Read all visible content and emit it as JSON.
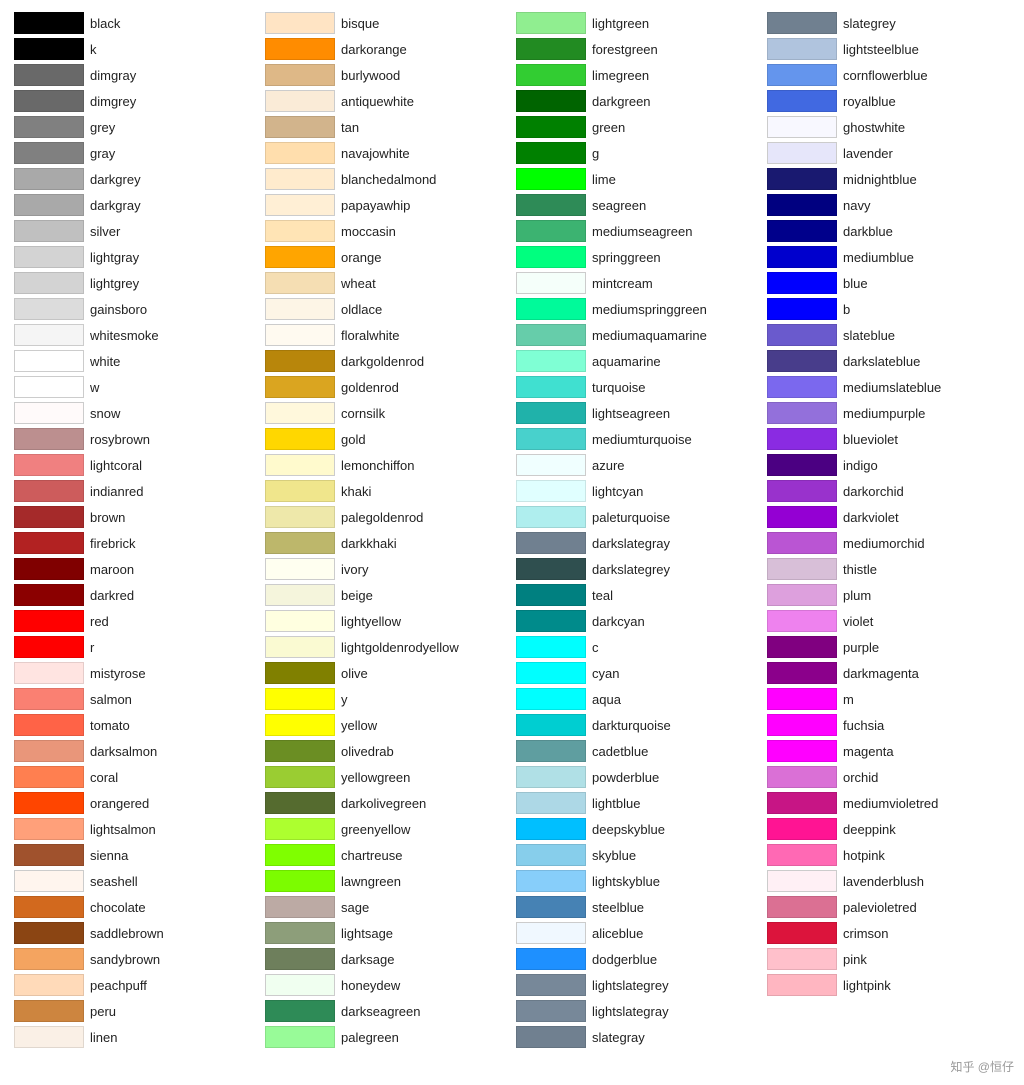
{
  "columns": [
    [
      {
        "color": "#000000",
        "name": "black"
      },
      {
        "color": "#000000",
        "name": "k"
      },
      {
        "color": "#696969",
        "name": "dimgray"
      },
      {
        "color": "#696969",
        "name": "dimgrey"
      },
      {
        "color": "#808080",
        "name": "grey"
      },
      {
        "color": "#808080",
        "name": "gray"
      },
      {
        "color": "#a9a9a9",
        "name": "darkgrey"
      },
      {
        "color": "#a9a9a9",
        "name": "darkgray"
      },
      {
        "color": "#c0c0c0",
        "name": "silver"
      },
      {
        "color": "#d3d3d3",
        "name": "lightgray"
      },
      {
        "color": "#d3d3d3",
        "name": "lightgrey"
      },
      {
        "color": "#dcdcdc",
        "name": "gainsboro"
      },
      {
        "color": "#f5f5f5",
        "name": "whitesmoke"
      },
      {
        "color": "#ffffff",
        "name": "white"
      },
      {
        "color": "#ffffff",
        "name": "w"
      },
      {
        "color": "#fffafa",
        "name": "snow"
      },
      {
        "color": "#bc8f8f",
        "name": "rosybrown"
      },
      {
        "color": "#f08080",
        "name": "lightcoral"
      },
      {
        "color": "#cd5c5c",
        "name": "indianred"
      },
      {
        "color": "#a52a2a",
        "name": "brown"
      },
      {
        "color": "#b22222",
        "name": "firebrick"
      },
      {
        "color": "#800000",
        "name": "maroon"
      },
      {
        "color": "#8b0000",
        "name": "darkred"
      },
      {
        "color": "#ff0000",
        "name": "red"
      },
      {
        "color": "#ff0000",
        "name": "r"
      },
      {
        "color": "#ffe4e1",
        "name": "mistyrose"
      },
      {
        "color": "#fa8072",
        "name": "salmon"
      },
      {
        "color": "#ff6347",
        "name": "tomato"
      },
      {
        "color": "#e9967a",
        "name": "darksalmon"
      },
      {
        "color": "#ff7f50",
        "name": "coral"
      },
      {
        "color": "#ff4500",
        "name": "orangered"
      },
      {
        "color": "#ffa07a",
        "name": "lightsalmon"
      },
      {
        "color": "#a0522d",
        "name": "sienna"
      },
      {
        "color": "#fff5ee",
        "name": "seashell"
      },
      {
        "color": "#d2691e",
        "name": "chocolate"
      },
      {
        "color": "#8b4513",
        "name": "saddlebrown"
      },
      {
        "color": "#f4a460",
        "name": "sandybrown"
      },
      {
        "color": "#ffdab9",
        "name": "peachpuff"
      },
      {
        "color": "#cd853f",
        "name": "peru"
      },
      {
        "color": "#faf0e6",
        "name": "linen"
      }
    ],
    [
      {
        "color": "#ffe4c4",
        "name": "bisque"
      },
      {
        "color": "#ff8c00",
        "name": "darkorange"
      },
      {
        "color": "#deb887",
        "name": "burlywood"
      },
      {
        "color": "#faebd7",
        "name": "antiquewhite"
      },
      {
        "color": "#d2b48c",
        "name": "tan"
      },
      {
        "color": "#ffdead",
        "name": "navajowhite"
      },
      {
        "color": "#ffebcd",
        "name": "blanchedalmond"
      },
      {
        "color": "#ffefd5",
        "name": "papayawhip"
      },
      {
        "color": "#ffe4b5",
        "name": "moccasin"
      },
      {
        "color": "#ffa500",
        "name": "orange"
      },
      {
        "color": "#f5deb3",
        "name": "wheat"
      },
      {
        "color": "#fdf5e6",
        "name": "oldlace"
      },
      {
        "color": "#fffaf0",
        "name": "floralwhite"
      },
      {
        "color": "#b8860b",
        "name": "darkgoldenrod"
      },
      {
        "color": "#daa520",
        "name": "goldenrod"
      },
      {
        "color": "#fff8dc",
        "name": "cornsilk"
      },
      {
        "color": "#ffd700",
        "name": "gold"
      },
      {
        "color": "#fffacd",
        "name": "lemonchiffon"
      },
      {
        "color": "#f0e68c",
        "name": "khaki"
      },
      {
        "color": "#eee8aa",
        "name": "palegoldenrod"
      },
      {
        "color": "#bdb76b",
        "name": "darkkhaki"
      },
      {
        "color": "#fffff0",
        "name": "ivory"
      },
      {
        "color": "#f5f5dc",
        "name": "beige"
      },
      {
        "color": "#ffffe0",
        "name": "lightyellow"
      },
      {
        "color": "#fafad2",
        "name": "lightgoldenrodyellow"
      },
      {
        "color": "#808000",
        "name": "olive"
      },
      {
        "color": "#ffff00",
        "name": "y"
      },
      {
        "color": "#ffff00",
        "name": "yellow"
      },
      {
        "color": "#6b8e23",
        "name": "olivedrab"
      },
      {
        "color": "#9acd32",
        "name": "yellowgreen"
      },
      {
        "color": "#556b2f",
        "name": "darkolivegreen"
      },
      {
        "color": "#adff2f",
        "name": "greenyellow"
      },
      {
        "color": "#7fff00",
        "name": "chartreuse"
      },
      {
        "color": "#7cfc00",
        "name": "lawngreen"
      },
      {
        "color": "#bcaaa4",
        "name": "sage"
      },
      {
        "color": "#8d9e7a",
        "name": "lightsage"
      },
      {
        "color": "#6e7f5c",
        "name": "darksage"
      },
      {
        "color": "#f0fff0",
        "name": "honeydew"
      },
      {
        "color": "#2e8b57",
        "name": "darkseagreen"
      },
      {
        "color": "#98fb98",
        "name": "palegreen"
      }
    ],
    [
      {
        "color": "#90ee90",
        "name": "lightgreen"
      },
      {
        "color": "#228b22",
        "name": "forestgreen"
      },
      {
        "color": "#32cd32",
        "name": "limegreen"
      },
      {
        "color": "#006400",
        "name": "darkgreen"
      },
      {
        "color": "#008000",
        "name": "green"
      },
      {
        "color": "#008000",
        "name": "g"
      },
      {
        "color": "#00ff00",
        "name": "lime"
      },
      {
        "color": "#2e8b57",
        "name": "seagreen"
      },
      {
        "color": "#3cb371",
        "name": "mediumseagreen"
      },
      {
        "color": "#00ff7f",
        "name": "springgreen"
      },
      {
        "color": "#f5fffa",
        "name": "mintcream"
      },
      {
        "color": "#00fa9a",
        "name": "mediumspringgreen"
      },
      {
        "color": "#66cdaa",
        "name": "mediumaquamarine"
      },
      {
        "color": "#7fffd4",
        "name": "aquamarine"
      },
      {
        "color": "#40e0d0",
        "name": "turquoise"
      },
      {
        "color": "#20b2aa",
        "name": "lightseagreen"
      },
      {
        "color": "#48d1cc",
        "name": "mediumturquoise"
      },
      {
        "color": "#f0ffff",
        "name": "azure"
      },
      {
        "color": "#e0ffff",
        "name": "lightcyan"
      },
      {
        "color": "#afeeee",
        "name": "paleturquoise"
      },
      {
        "color": "#708090",
        "name": "darkslategray"
      },
      {
        "color": "#2f4f4f",
        "name": "darkslategrey"
      },
      {
        "color": "#008080",
        "name": "teal"
      },
      {
        "color": "#008b8b",
        "name": "darkcyan"
      },
      {
        "color": "#00ffff",
        "name": "c"
      },
      {
        "color": "#00ffff",
        "name": "cyan"
      },
      {
        "color": "#00ffff",
        "name": "aqua"
      },
      {
        "color": "#00ced1",
        "name": "darkturquoise"
      },
      {
        "color": "#5f9ea0",
        "name": "cadetblue"
      },
      {
        "color": "#b0e0e6",
        "name": "powderblue"
      },
      {
        "color": "#add8e6",
        "name": "lightblue"
      },
      {
        "color": "#00bfff",
        "name": "deepskyblue"
      },
      {
        "color": "#87ceeb",
        "name": "skyblue"
      },
      {
        "color": "#87cefa",
        "name": "lightskyblue"
      },
      {
        "color": "#4682b4",
        "name": "steelblue"
      },
      {
        "color": "#f0f8ff",
        "name": "aliceblue"
      },
      {
        "color": "#1e90ff",
        "name": "dodgerblue"
      },
      {
        "color": "#778899",
        "name": "lightslategrey"
      },
      {
        "color": "#778899",
        "name": "lightslategray"
      },
      {
        "color": "#708090",
        "name": "slategray"
      }
    ],
    [
      {
        "color": "#708090",
        "name": "slategrey"
      },
      {
        "color": "#b0c4de",
        "name": "lightsteelblue"
      },
      {
        "color": "#6495ed",
        "name": "cornflowerblue"
      },
      {
        "color": "#4169e1",
        "name": "royalblue"
      },
      {
        "color": "#f8f8ff",
        "name": "ghostwhite"
      },
      {
        "color": "#e6e6fa",
        "name": "lavender"
      },
      {
        "color": "#191970",
        "name": "midnightblue"
      },
      {
        "color": "#000080",
        "name": "navy"
      },
      {
        "color": "#00008b",
        "name": "darkblue"
      },
      {
        "color": "#0000cd",
        "name": "mediumblue"
      },
      {
        "color": "#0000ff",
        "name": "blue"
      },
      {
        "color": "#0000ff",
        "name": "b"
      },
      {
        "color": "#6a5acd",
        "name": "slateblue"
      },
      {
        "color": "#483d8b",
        "name": "darkslateblue"
      },
      {
        "color": "#7b68ee",
        "name": "mediumslateblue"
      },
      {
        "color": "#9370db",
        "name": "mediumpurple"
      },
      {
        "color": "#8a2be2",
        "name": "blueviolet"
      },
      {
        "color": "#4b0082",
        "name": "indigo"
      },
      {
        "color": "#9932cc",
        "name": "darkorchid"
      },
      {
        "color": "#9400d3",
        "name": "darkviolet"
      },
      {
        "color": "#ba55d3",
        "name": "mediumorchid"
      },
      {
        "color": "#d8bfd8",
        "name": "thistle"
      },
      {
        "color": "#dda0dd",
        "name": "plum"
      },
      {
        "color": "#ee82ee",
        "name": "violet"
      },
      {
        "color": "#800080",
        "name": "purple"
      },
      {
        "color": "#8b008b",
        "name": "darkmagenta"
      },
      {
        "color": "#ff00ff",
        "name": "m"
      },
      {
        "color": "#ff00ff",
        "name": "fuchsia"
      },
      {
        "color": "#ff00ff",
        "name": "magenta"
      },
      {
        "color": "#da70d6",
        "name": "orchid"
      },
      {
        "color": "#c71585",
        "name": "mediumvioletred"
      },
      {
        "color": "#ff1493",
        "name": "deeppink"
      },
      {
        "color": "#ff69b4",
        "name": "hotpink"
      },
      {
        "color": "#fff0f5",
        "name": "lavenderblush"
      },
      {
        "color": "#db7093",
        "name": "palevioletred"
      },
      {
        "color": "#dc143c",
        "name": "crimson"
      },
      {
        "color": "#ffc0cb",
        "name": "pink"
      },
      {
        "color": "#ffb6c1",
        "name": "lightpink"
      }
    ]
  ],
  "watermark": "知乎 @恒仔"
}
